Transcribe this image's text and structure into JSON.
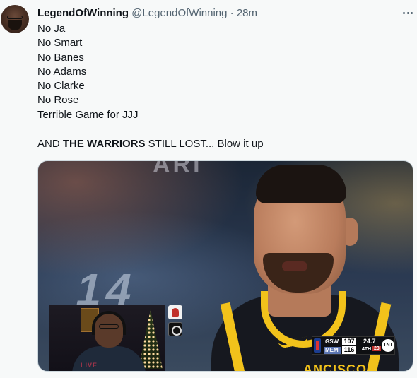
{
  "tweet": {
    "author_name": "LegendOfWinning",
    "author_handle": "@LegendOfWinning",
    "separator": "·",
    "time_ago": "28m",
    "lines": [
      "No Ja",
      "No Smart",
      "No Banes",
      "No Adams",
      "No Clarke",
      "No Rose",
      "Terrible Game for JJJ"
    ],
    "last_line": {
      "prefix": "AND ",
      "bold": "THE WARRIORS",
      "suffix": " STILL LOST... Blow it up"
    }
  },
  "media": {
    "scorebug": {
      "team1": "GSW",
      "score1": "107",
      "team2": "MEM",
      "score2": "116",
      "clock": "24.7",
      "quarter": "4TH",
      "shot_clock": "23",
      "network": "TNT"
    }
  },
  "icons": {
    "more": "more-horizontal-icon"
  },
  "colors": {
    "text": "#0f1419",
    "secondary": "#536471",
    "warriors_gold": "#f2c21b"
  }
}
